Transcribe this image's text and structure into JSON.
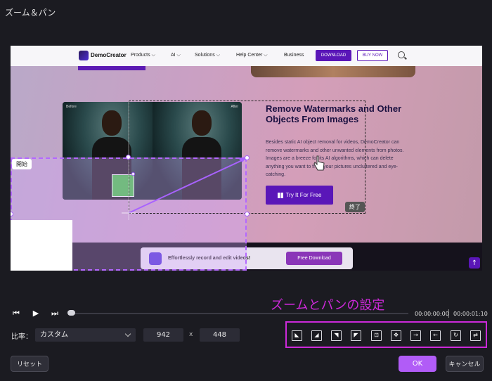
{
  "dialog": {
    "title": "ズーム＆パン"
  },
  "preview": {
    "site": {
      "brand": "DemoCreator",
      "nav": [
        "Products ⌵",
        "AI ⌵",
        "Solutions ⌵",
        "Help Center ⌵",
        "Business"
      ],
      "download_btn": "DOWNLOAD",
      "buy_btn": "BUY NOW",
      "photo_before": "Before",
      "photo_after": "After",
      "headline": "Remove Watermarks and Other Objects From Images",
      "body": "Besides static AI object removal for videos, DemoCreator can remove watermarks and other unwanted elements from photos. Images are a breeze for its AI algorithms, which can delete anything you want to from your pictures uncluttered and eye-catching.",
      "try_btn": "Try It For Free",
      "promo_text": "Effortlessly record and edit videos!",
      "promo_btn": "Free Download"
    },
    "start_tag": "開始",
    "end_tag": "終了"
  },
  "timeline": {
    "current_time": "00:00:00:00",
    "total_time": "00:00:01:10",
    "progress": 0
  },
  "settings_label": "ズームとパンの設定",
  "ratio": {
    "label": "比率：",
    "selected": "カスタム",
    "width": "942",
    "times": "x",
    "height": "448"
  },
  "presets": [
    "zoom-in-top-left-icon",
    "zoom-in-top-right-icon",
    "zoom-out-top-right-icon",
    "zoom-out-top-left-icon",
    "zoom-in-center-icon",
    "zoom-out-center-icon",
    "pan-right-icon",
    "pan-left-icon",
    "rotate-icon",
    "pan-horizontal-icon"
  ],
  "buttons": {
    "reset": "リセット",
    "ok": "OK",
    "cancel": "キャンセル"
  },
  "colors": {
    "accent": "#b15cf7",
    "highlight": "#cc29d9"
  }
}
